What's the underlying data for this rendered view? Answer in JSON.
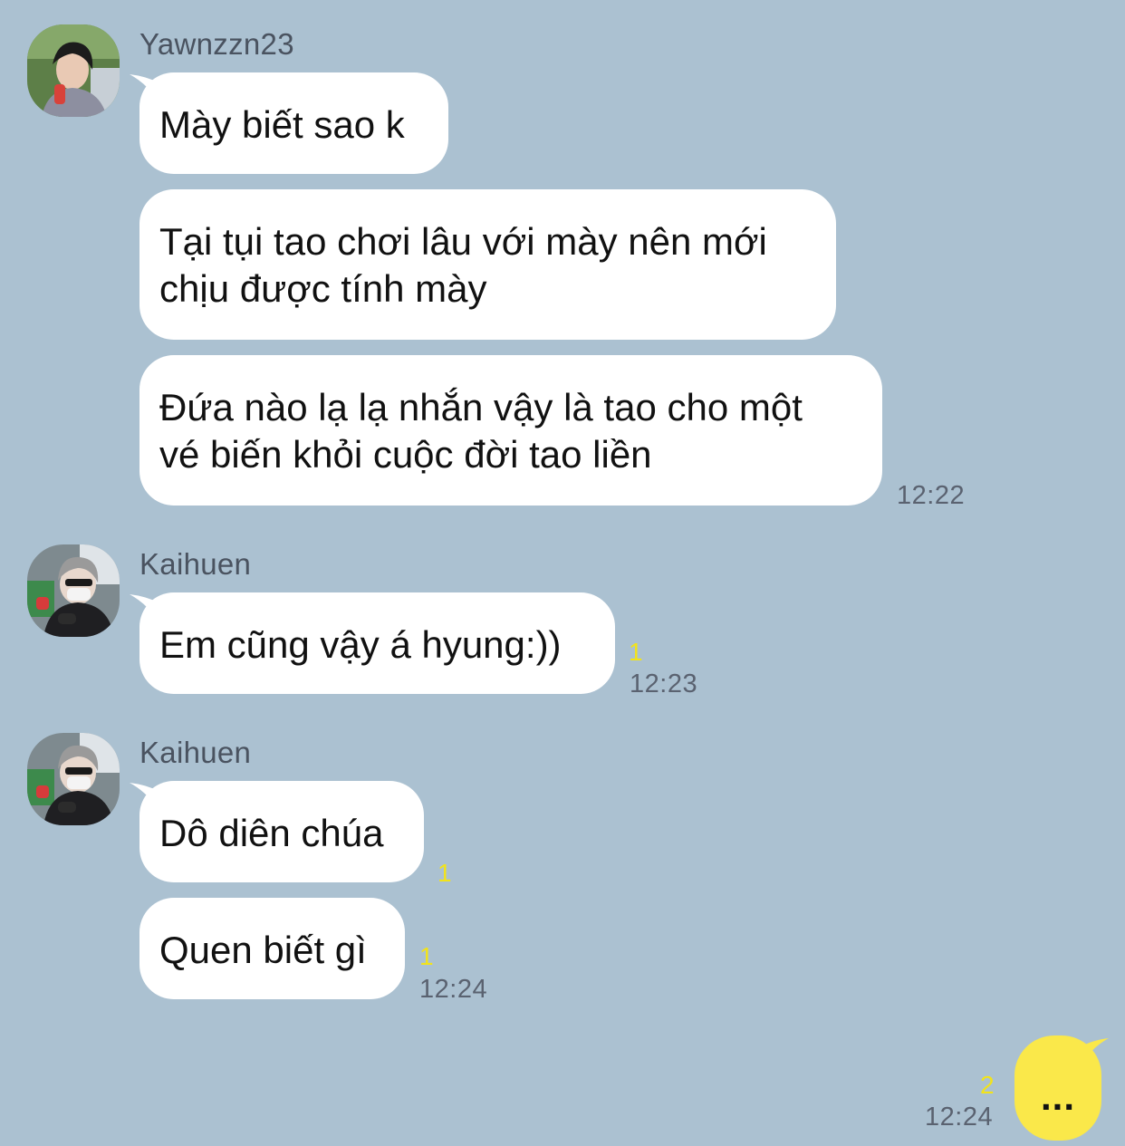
{
  "colors": {
    "background": "#abc1d1",
    "incoming_bubble": "#ffffff",
    "outgoing_bubble": "#fae84a",
    "unread_count": "#f2e31a",
    "timestamp": "#5a6270"
  },
  "groups": [
    {
      "sender": "Yawnzzn23",
      "avatar_icon": "user-avatar-photo",
      "messages": [
        {
          "lines": [
            "Mày biết sao k"
          ]
        },
        {
          "lines": [
            "Tại tụi tao chơi lâu với mày nên mới",
            "chịu được tính mày"
          ]
        },
        {
          "lines": [
            "Đứa nào lạ lạ nhắn vậy là tao cho một",
            "vé biến khỏi cuộc đời tao liền"
          ],
          "time": "12:22"
        }
      ]
    },
    {
      "sender": "Kaihuen",
      "avatar_icon": "user-avatar-photo",
      "messages": [
        {
          "lines": [
            "Em cũng vậy á hyung:))"
          ],
          "unread": "1",
          "time": "12:23"
        }
      ]
    },
    {
      "sender": "Kaihuen",
      "avatar_icon": "user-avatar-photo",
      "messages": [
        {
          "lines": [
            "Dô diên chúa"
          ],
          "unread": "1"
        },
        {
          "lines": [
            "Quen biết gì"
          ],
          "unread": "1",
          "time": "12:24"
        }
      ]
    }
  ],
  "outgoing": {
    "text": "...",
    "unread": "2",
    "time": "12:24"
  }
}
